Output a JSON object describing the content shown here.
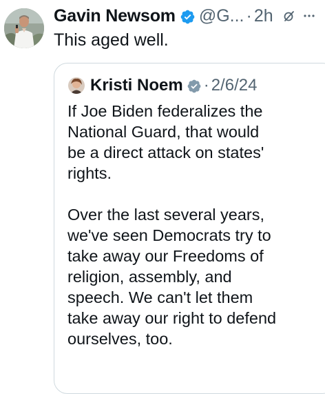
{
  "colors": {
    "text": "#0f1419",
    "secondary": "#536471",
    "verified": "#1d9bf0",
    "quote_verified": "#829aab",
    "border": "#cfd9de"
  },
  "tweet": {
    "author_name": "Gavin Newsom",
    "handle": "@G...",
    "separator": "·",
    "time": "2h",
    "text": "This aged well.",
    "icons": [
      "avatar",
      "verified-badge-icon",
      "grok-icon",
      "more-icon"
    ]
  },
  "quoted_tweet": {
    "author_name": "Kristi Noem",
    "separator": "·",
    "date": "2/6/24",
    "text": "If Joe Biden federalizes the\nNational Guard, that would\nbe a direct attack on states'\nrights.\n\nOver the last several years,\nwe've seen Democrats try to\ntake away our Freedoms of\nreligion, assembly, and\nspeech. We can't let them\ntake away our right to defend\nourselves, too.",
    "icons": [
      "quote-avatar",
      "verified-badge-icon"
    ]
  }
}
